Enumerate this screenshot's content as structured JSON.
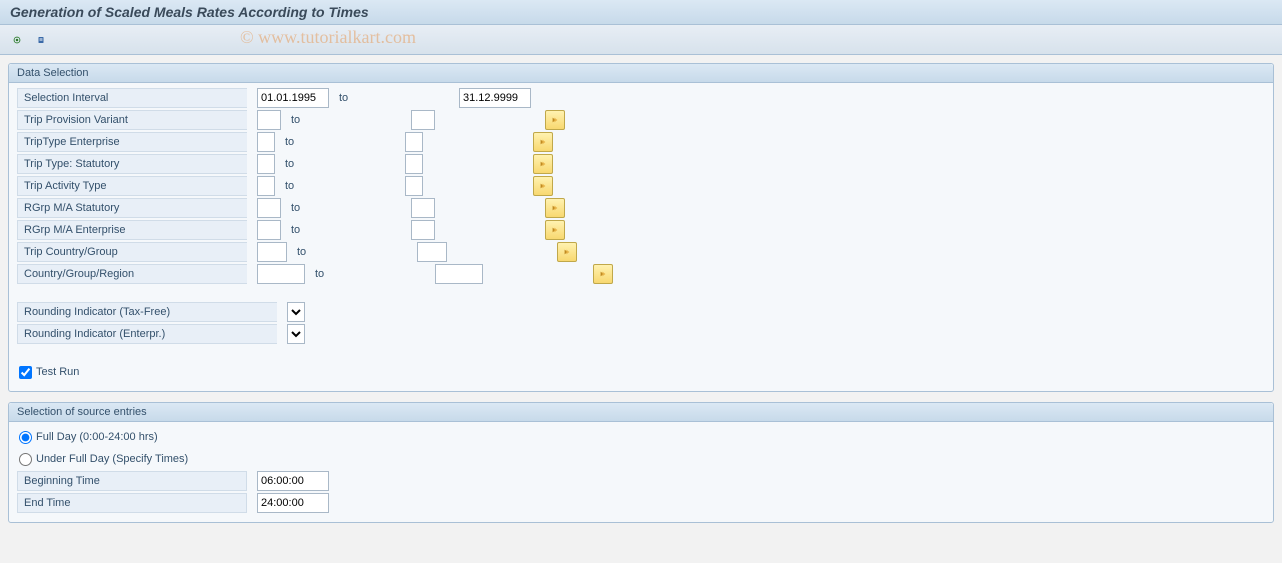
{
  "title": "Generation of Scaled Meals Rates According to Times",
  "watermark": "© www.tutorialkart.com",
  "groups": {
    "data_selection": {
      "title": "Data Selection",
      "rows": {
        "selection_interval": {
          "label": "Selection Interval",
          "from": "01.01.1995",
          "to_label": "to",
          "to": "31.12.9999"
        },
        "trip_provision_variant": {
          "label": "Trip Provision Variant",
          "from": "",
          "to_label": "to",
          "to": ""
        },
        "trip_type_enterprise": {
          "label": "TripType Enterprise",
          "from": "",
          "to_label": "to",
          "to": ""
        },
        "trip_type_statutory": {
          "label": "Trip Type: Statutory",
          "from": "",
          "to_label": "to",
          "to": ""
        },
        "trip_activity_type": {
          "label": "Trip Activity Type",
          "from": "",
          "to_label": "to",
          "to": ""
        },
        "rgrp_ma_statutory": {
          "label": "RGrp M/A Statutory",
          "from": "",
          "to_label": "to",
          "to": ""
        },
        "rgrp_ma_enterprise": {
          "label": "RGrp M/A Enterprise",
          "from": "",
          "to_label": "to",
          "to": ""
        },
        "trip_country_group": {
          "label": "Trip Country/Group",
          "from": "",
          "to_label": "to",
          "to": ""
        },
        "country_group_region": {
          "label": "Country/Group/Region",
          "from": "",
          "to_label": "to",
          "to": ""
        }
      },
      "rounding_tax": {
        "label": "Rounding Indicator (Tax-Free)",
        "value": ""
      },
      "rounding_ent": {
        "label": "Rounding Indicator (Enterpr.)",
        "value": ""
      },
      "test_run": {
        "label": "Test Run",
        "checked": true
      }
    },
    "source": {
      "title": "Selection of source entries",
      "full_day": {
        "label": "Full Day (0:00-24:00 hrs)",
        "selected": true
      },
      "under_full": {
        "label": "Under Full Day (Specify Times)",
        "selected": false
      },
      "beginning": {
        "label": "Beginning Time",
        "value": "06:00:00"
      },
      "end": {
        "label": "End Time",
        "value": "24:00:00"
      }
    }
  }
}
